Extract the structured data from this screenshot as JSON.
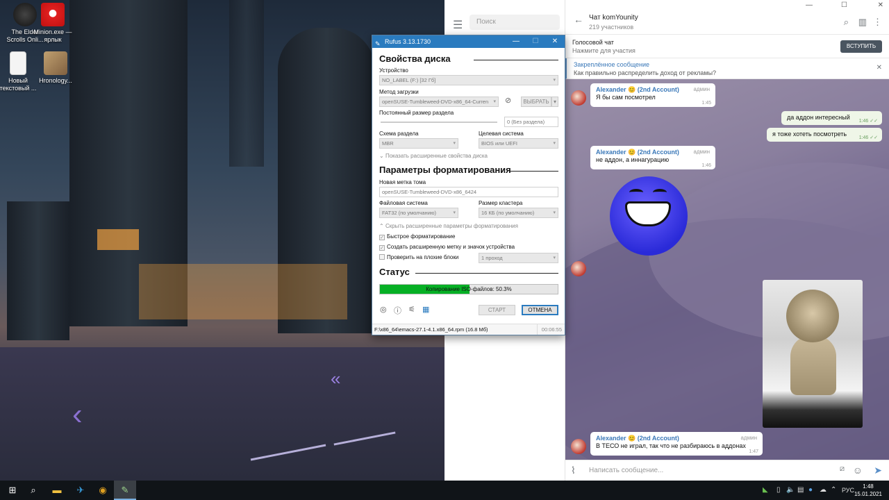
{
  "desktop": {
    "icons": [
      {
        "label": "The Elder Scrolls Onli..."
      },
      {
        "label": "Minion.exe — ярлык"
      },
      {
        "label": "Новый текстовый ..."
      },
      {
        "label": "Hronology..."
      }
    ]
  },
  "telegram": {
    "search_placeholder": "Поиск",
    "chat_title": "Чат komYounity",
    "chat_subtitle": "219 участников",
    "voice_chat_title": "Голосовой чат",
    "voice_chat_sub": "Нажмите для участия",
    "join_label": "ВСТУПИТЬ",
    "pinned_title": "Закреплённое сообщение",
    "pinned_text": "Как правильно распределить доход от рекламы?",
    "messages": [
      {
        "from": "Alexander 😊 (2nd Account)",
        "role": "админ",
        "text": "Я бы сам посмотрел",
        "time": "1:45"
      },
      {
        "text": "да аддон интересный",
        "time": "1:46 ✓✓"
      },
      {
        "text": "я тоже хотеть посмотреть",
        "time": "1:46 ✓✓"
      },
      {
        "from": "Alexander 😊 (2nd Account)",
        "role": "админ",
        "text": "не аддон, а иннагурацию",
        "time": "1:46"
      },
      {
        "from": "Alexander 😊 (2nd Account)",
        "role": "админ",
        "text": "В ТЕСО не играл, так что не разбираюсь в аддонах",
        "time": "1:47"
      }
    ],
    "composer_placeholder": "Написать сообщение..."
  },
  "rufus": {
    "title": "Rufus 3.13.1730",
    "sections": {
      "drive_properties": "Свойства диска",
      "format_options": "Параметры форматирования",
      "status": "Статус"
    },
    "device_label": "Устройство",
    "device_value": "NO_LABEL (F:) [32 Гб]",
    "boot_label": "Метод загрузки",
    "boot_value": "openSUSE-Tumbleweed-DVD-x86_64-Curren",
    "select_label": "ВЫБРАТЬ",
    "persistent_label": "Постоянный размер раздела",
    "persistent_value": "0 (Без раздела)",
    "scheme_label": "Схема раздела",
    "scheme_value": "MBR",
    "target_label": "Целевая система",
    "target_value": "BIOS или UEFI",
    "show_advanced_drive": "Показать расширенные свойства диска",
    "volume_label": "Новая метка тома",
    "volume_value": "openSUSE-Tumbleweed-DVD-x86_6424",
    "fs_label": "Файловая система",
    "fs_value": "FAT32 (по умолчанию)",
    "cluster_label": "Размер кластера",
    "cluster_value": "16 КБ (по умолчанию)",
    "hide_advanced_format": "Скрыть расширенные параметры форматирования",
    "quick_format": "Быстрое форматирование",
    "extended_label": "Создать расширенную метку и значок устройства",
    "bad_blocks": "Проверить на плохие блоки",
    "passes_value": "1 проход",
    "progress_text": "Копирование ISO-файлов: 50.3%",
    "progress": 0.503,
    "start_label": "СТАРТ",
    "cancel_label": "ОТМЕНА",
    "status_file": "F:\\x86_64\\emacs-27.1-4.1.x86_64.rpm (16.8 Мб)",
    "elapsed": "00:06:55"
  },
  "taskbar": {
    "lang": "РУС",
    "time": "1:48",
    "date": "15.01.2021"
  }
}
